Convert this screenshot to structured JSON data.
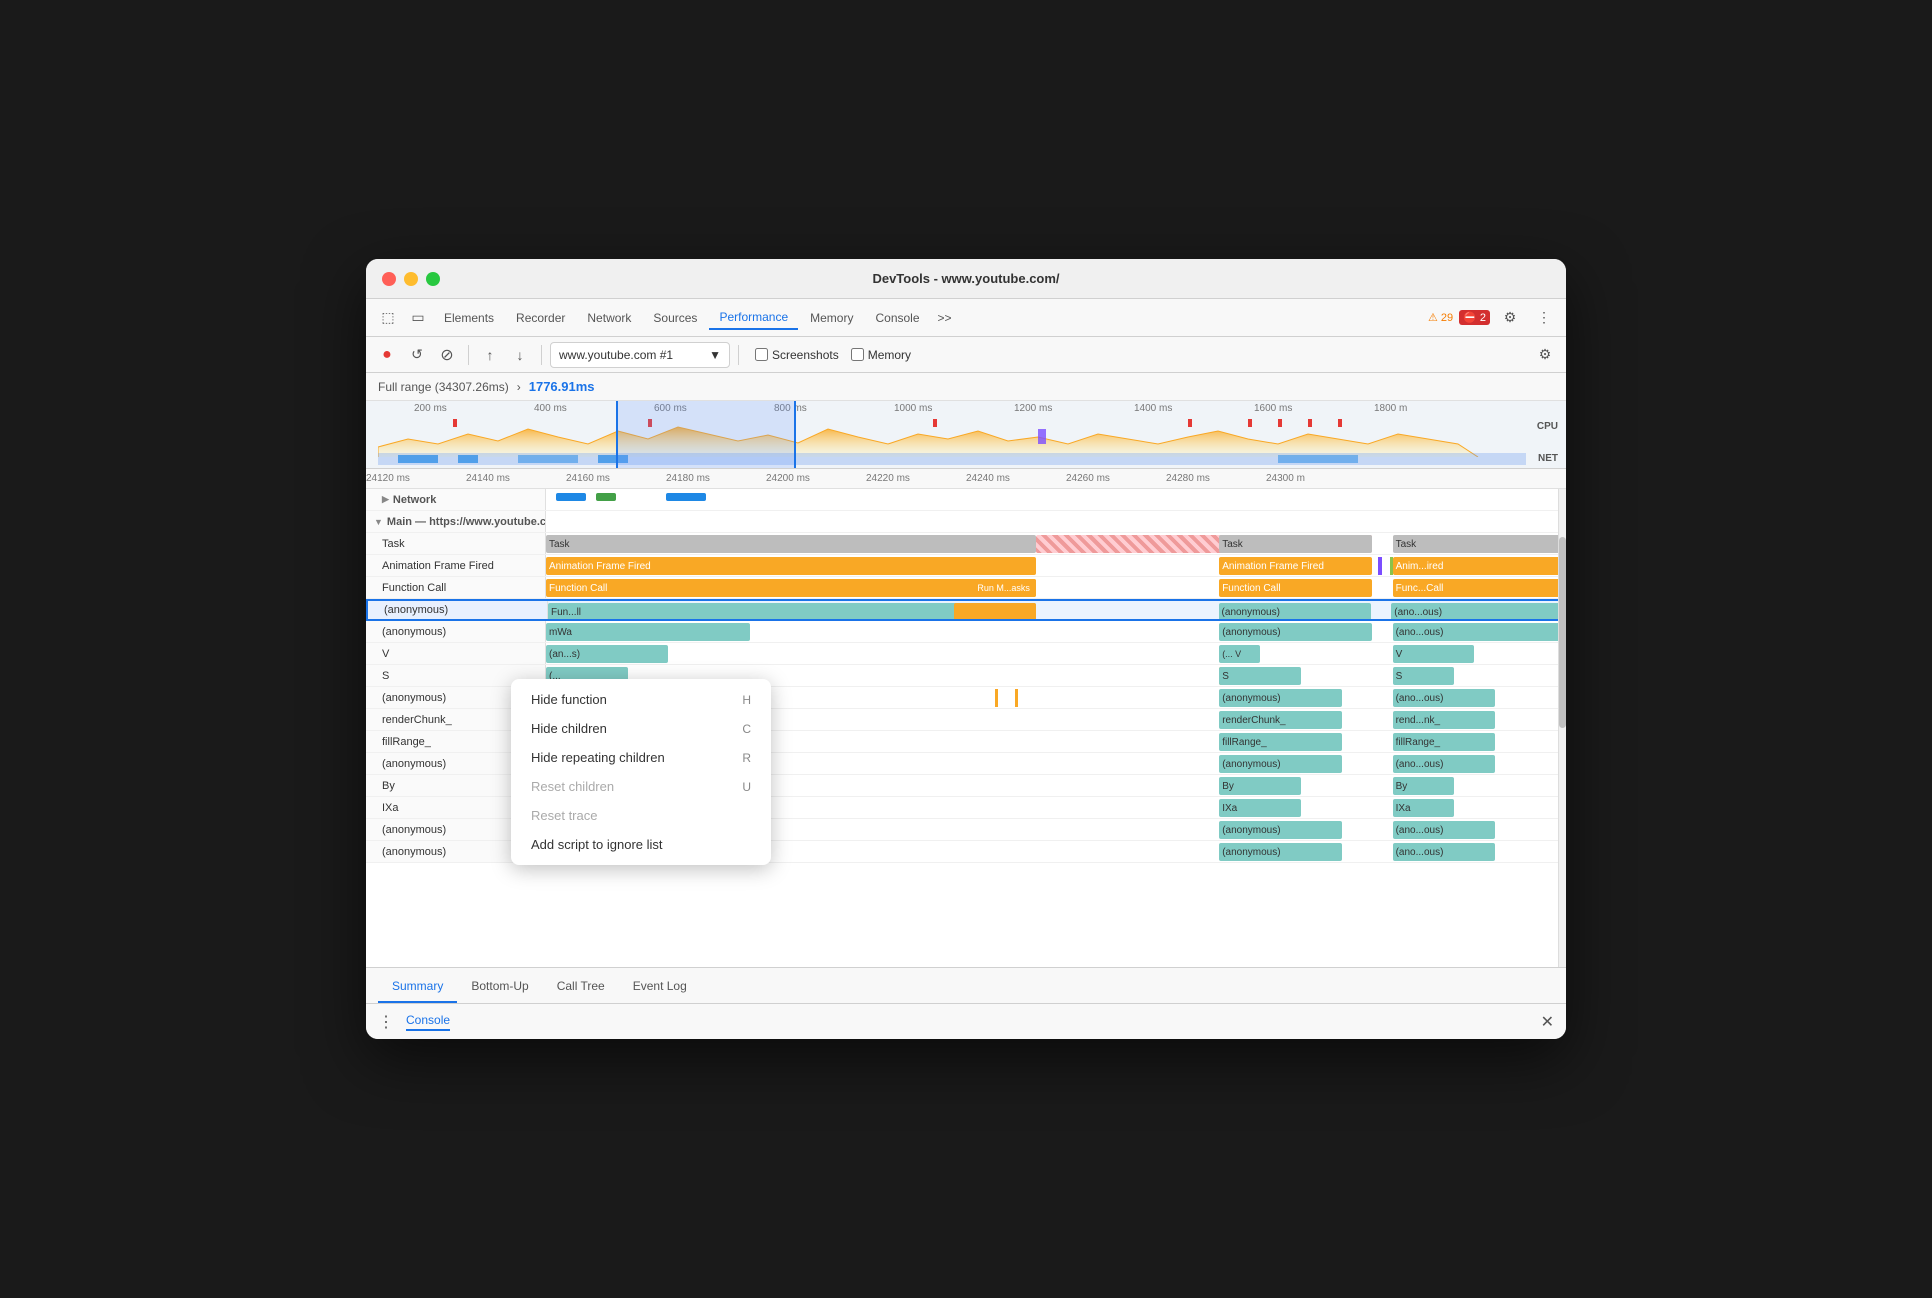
{
  "window": {
    "title": "DevTools - www.youtube.com/"
  },
  "tabs": {
    "items": [
      {
        "label": "Elements",
        "active": false
      },
      {
        "label": "Recorder",
        "active": false
      },
      {
        "label": "Network",
        "active": false
      },
      {
        "label": "Sources",
        "active": false
      },
      {
        "label": "Performance",
        "active": true
      },
      {
        "label": "Memory",
        "active": false
      },
      {
        "label": "Console",
        "active": false
      }
    ],
    "more": ">>",
    "warning_count": "29",
    "error_count": "2"
  },
  "toolbar": {
    "record_label": "●",
    "reload_label": "↺",
    "clear_label": "⊘",
    "upload_label": "↑",
    "download_label": "↓",
    "url": "www.youtube.com #1",
    "screenshots_label": "Screenshots",
    "memory_label": "Memory",
    "settings_label": "⚙"
  },
  "range": {
    "full_range": "Full range (34307.26ms)",
    "arrow": "›",
    "highlight": "1776.91ms"
  },
  "timeline": {
    "overview_ticks": [
      "200 ms",
      "400 ms",
      "600 ms",
      "800 ms",
      "1000 ms",
      "1200 ms",
      "1400 ms",
      "1600 ms",
      "1800 m"
    ],
    "ms_ticks": [
      "24120 ms",
      "24140 ms",
      "24160 ms",
      "24180 ms",
      "24200 ms",
      "24220 ms",
      "24240 ms",
      "24260 ms",
      "24280 ms",
      "24300 m"
    ]
  },
  "tracks": {
    "network_label": "Network",
    "main_label": "Main — https://www.youtube.com/",
    "rows": [
      {
        "label": "Task",
        "type": "task"
      },
      {
        "label": "Animation Frame Fired",
        "type": "anim"
      },
      {
        "label": "Function Call",
        "type": "func"
      },
      {
        "label": "(anonymous)",
        "type": "anon",
        "selected": true
      },
      {
        "label": "(anonymous)",
        "type": "anon2"
      },
      {
        "label": "V",
        "type": "v"
      },
      {
        "label": "S",
        "type": "s"
      },
      {
        "label": "(anonymous)",
        "type": "anon3"
      },
      {
        "label": "renderChunk_",
        "type": "render"
      },
      {
        "label": "fillRange_",
        "type": "fill"
      },
      {
        "label": "(anonymous)",
        "type": "anon4"
      },
      {
        "label": "By",
        "type": "by"
      },
      {
        "label": "IXa",
        "type": "ixa"
      },
      {
        "label": "(anonymous)",
        "type": "anon5"
      },
      {
        "label": "(anonymous)",
        "type": "anon6"
      }
    ],
    "right_col_1": [
      {
        "label": "Task"
      },
      {
        "label": "Animation Frame Fired"
      },
      {
        "label": "Function Call"
      },
      {
        "label": "(anonymous)"
      },
      {
        "label": "(anonymous)"
      },
      {
        "label": "(... V"
      },
      {
        "label": "S"
      },
      {
        "label": "(anonymous)"
      },
      {
        "label": "renderChunk_"
      },
      {
        "label": "fillRange_"
      },
      {
        "label": "(anonymous)"
      },
      {
        "label": "By"
      },
      {
        "label": "IXa"
      },
      {
        "label": "(anonymous)"
      },
      {
        "label": "(anonymous)"
      }
    ],
    "right_col_2": [
      {
        "label": "Task"
      },
      {
        "label": "Anim...ired"
      },
      {
        "label": "Func...Call"
      },
      {
        "label": "(ano...ous)"
      },
      {
        "label": "(ano...ous)"
      },
      {
        "label": "V"
      },
      {
        "label": "S"
      },
      {
        "label": "(ano...ous)"
      },
      {
        "label": "rend...nk_"
      },
      {
        "label": "fillRange_"
      },
      {
        "label": "(ano...ous)"
      },
      {
        "label": "By"
      },
      {
        "label": "IXa"
      },
      {
        "label": "(ano...ous)"
      },
      {
        "label": "(ano...ous)"
      }
    ]
  },
  "context_menu": {
    "items": [
      {
        "label": "Hide function",
        "shortcut": "H",
        "disabled": false
      },
      {
        "label": "Hide children",
        "shortcut": "C",
        "disabled": false
      },
      {
        "label": "Hide repeating children",
        "shortcut": "R",
        "disabled": false
      },
      {
        "label": "Reset children",
        "shortcut": "U",
        "disabled": true
      },
      {
        "label": "Reset trace",
        "shortcut": "",
        "disabled": true
      },
      {
        "label": "Add script to ignore list",
        "shortcut": "",
        "disabled": false
      }
    ]
  },
  "bottom_tabs": [
    {
      "label": "Summary",
      "active": true
    },
    {
      "label": "Bottom-Up",
      "active": false
    },
    {
      "label": "Call Tree",
      "active": false
    },
    {
      "label": "Event Log",
      "active": false
    }
  ],
  "console": {
    "dots": "⋮",
    "label": "Console",
    "close": "✕"
  },
  "mid_labels": {
    "run_masks": "Run M...asks",
    "fun_ll": "Fun...ll",
    "mwa": "mWa",
    "an_s": "(an...s)",
    "paren": "(..."
  }
}
